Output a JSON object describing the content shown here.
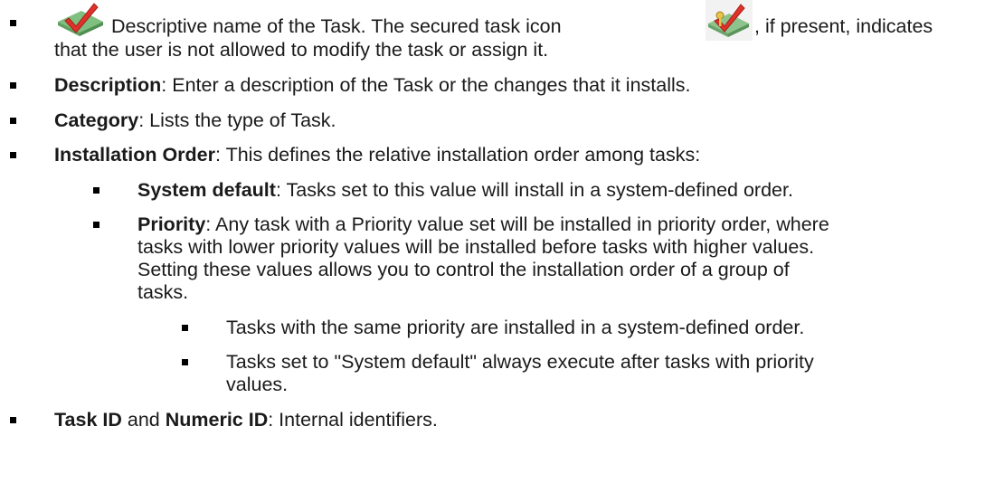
{
  "items": {
    "task": {
      "text_a": "Descriptive name of the Task. The secured task icon ",
      "text_b": ", if present, indicates",
      "text_c": "that the user is not allowed to modify the task or assign it."
    },
    "description": {
      "label": "Description",
      "text": ": Enter a description of the Task or the changes that it installs."
    },
    "category": {
      "label": "Category",
      "text": ": Lists the type of Task."
    },
    "installation_order": {
      "label": "Installation Order",
      "text": ": This defines the relative installation order among tasks:"
    },
    "system_default": {
      "label": "System default",
      "text": ": Tasks set to this value will install in a system-defined order."
    },
    "priority": {
      "label": "Priority",
      "text_1": ": Any task with a Priority value set will be installed in priority order, where",
      "text_2": "tasks with lower priority values will be installed before tasks with higher values.",
      "text_3": "Setting these values allows you to control the installation order of a group of",
      "text_4": "tasks."
    },
    "same_priority": {
      "text": "Tasks with the same priority are installed in a system-defined order."
    },
    "system_default_after": {
      "text_1": "Tasks set to \"System default\" always execute after tasks with priority",
      "text_2": "values."
    },
    "ids": {
      "label_1": "Task ID",
      "mid": " and ",
      "label_2": "Numeric ID",
      "text": ": Internal identifiers."
    }
  },
  "icons": {
    "task_icon": "task-check-icon",
    "secured_icon": "secured-task-icon",
    "check_color": "#e0322b",
    "tile_color": "#8cc48c"
  }
}
